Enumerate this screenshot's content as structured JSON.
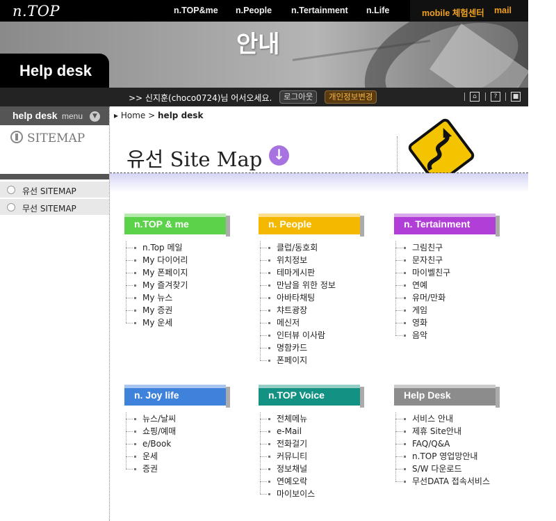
{
  "header": {
    "logo": "n.TOP",
    "nav": [
      "n.TOP&me",
      "n.People",
      "n.Tertainment",
      "n.Life"
    ],
    "mobile_center": "mobile 체험센터",
    "mail": "mail"
  },
  "banner": {
    "glyph": "안내",
    "section": "Help desk"
  },
  "userbar": {
    "greeting": ">> 신지훈(choco0724)님 어서오세요.",
    "logout": "로그아웃",
    "profile": "개인정보변경",
    "icons": [
      "home-icon",
      "help-icon",
      "sitemap-icon"
    ]
  },
  "sidebar": {
    "menu_title": "help desk",
    "menu_sub": "menu",
    "sitemap_label": "SITEMAP",
    "items": [
      "유선 SITEMAP",
      "무선 SITEMAP"
    ]
  },
  "breadcrumb": {
    "home": "Home",
    "separator": ">",
    "current": "help desk"
  },
  "page": {
    "title": "유선 Site Map"
  },
  "categories": [
    {
      "title": "n.TOP & me",
      "color": "#5bd24a",
      "items": [
        "n.Top 메일",
        "My 다이어리",
        "My 폰페이지",
        "My 즐겨찾기",
        "My 뉴스",
        "My 증권",
        "My 운세"
      ]
    },
    {
      "title": "n. People",
      "color": "#f5b800",
      "items": [
        "클럽/동호회",
        "위치정보",
        "테마게시판",
        "만남을 위한 정보",
        "아바타채팅",
        "챠트광장",
        "메신저",
        "인터뷰 이사람",
        "명함카드",
        "폰페이지"
      ]
    },
    {
      "title": "n. Tertainment",
      "color": "#b13ed6",
      "items": [
        "그림친구",
        "문자친구",
        "마이벨친구",
        "연예",
        "유머/만화",
        "게임",
        "영화",
        "음악"
      ]
    },
    {
      "title": "n. Joy life",
      "color": "#3f82dc",
      "items": [
        "뉴스/날씨",
        "쇼핑/예매",
        "e/Book",
        "운세",
        "증권"
      ]
    },
    {
      "title": "n.TOP Voice",
      "color": "#139283",
      "items": [
        "전체메뉴",
        "e-Mail",
        "전화걸기",
        "커뮤니티",
        "정보채널",
        "연예오락",
        "마이보이스"
      ]
    },
    {
      "title": "Help Desk",
      "color": "#8c8c8c",
      "items": [
        "서비스 안내",
        "제휴 Site안내",
        "FAQ/Q&A",
        "n.TOP 영업망안내",
        "S/W 다운로드",
        "무선DATA 접속서비스"
      ]
    }
  ]
}
